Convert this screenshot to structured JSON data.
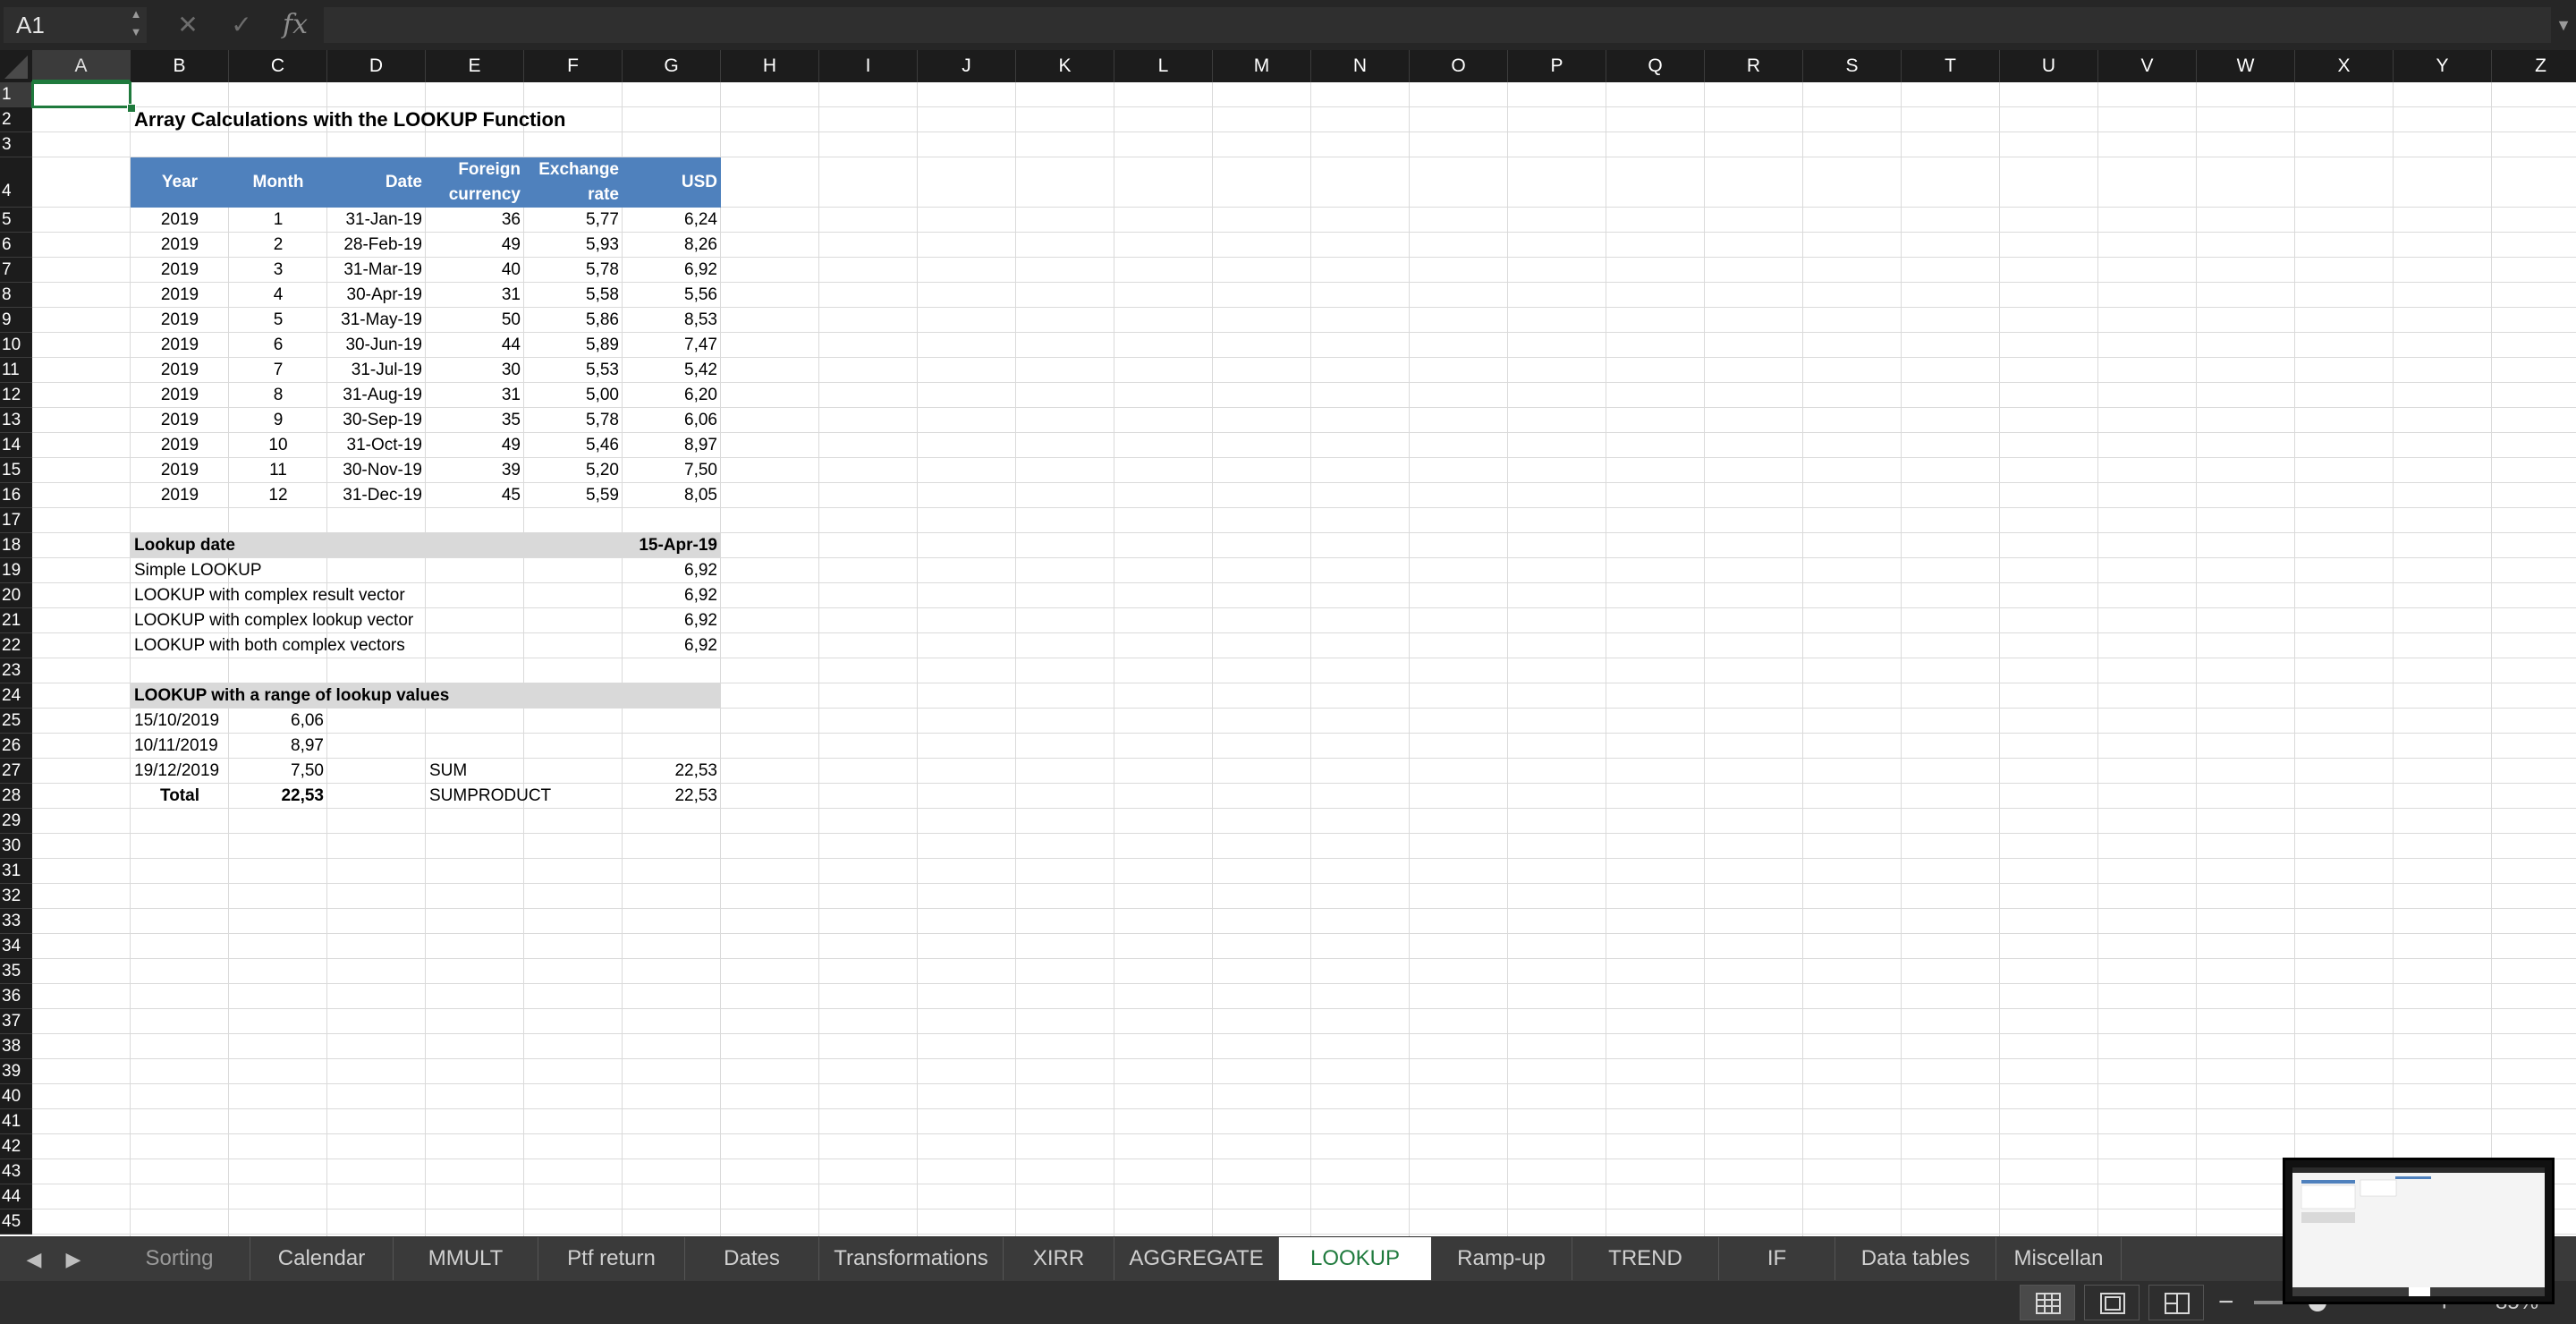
{
  "formula_bar": {
    "name_box": "A1",
    "formula": "",
    "icons": {
      "stepper": "stepper-icon",
      "cancel": "x-icon",
      "confirm": "check-icon",
      "fx": "function-icon",
      "dropdown": "chevron-down-icon"
    },
    "fx_label": "fx"
  },
  "columns": [
    "A",
    "B",
    "C",
    "D",
    "E",
    "F",
    "G",
    "H",
    "I",
    "J",
    "K",
    "L",
    "M",
    "N",
    "O",
    "P",
    "Q",
    "R",
    "S",
    "T",
    "U",
    "V",
    "W",
    "X",
    "Y",
    "Z"
  ],
  "selected_column": "A",
  "rows": [
    "1",
    "2",
    "3",
    "4",
    "5",
    "6",
    "7",
    "8",
    "9",
    "10",
    "11",
    "12",
    "13",
    "14",
    "15",
    "16",
    "17",
    "18",
    "19",
    "20",
    "21",
    "22",
    "23",
    "24",
    "25",
    "26",
    "27",
    "28",
    "29",
    "30",
    "31",
    "32",
    "33",
    "34",
    "35",
    "36",
    "37",
    "38",
    "39",
    "40",
    "41",
    "42",
    "43",
    "44",
    "45"
  ],
  "selected_row": "1",
  "sheet": {
    "title": "Array Calculations with the LOOKUP Function",
    "table_headers": {
      "year": "Year",
      "month": "Month",
      "date": "Date",
      "foreign_line1": "Foreign",
      "foreign_line2": "currency",
      "rate_line1": "Exchange",
      "rate_line2": "rate",
      "usd": "USD"
    },
    "table_rows": [
      [
        "2019",
        "1",
        "31-Jan-19",
        "36",
        "5,77",
        "6,24"
      ],
      [
        "2019",
        "2",
        "28-Feb-19",
        "49",
        "5,93",
        "8,26"
      ],
      [
        "2019",
        "3",
        "31-Mar-19",
        "40",
        "5,78",
        "6,92"
      ],
      [
        "2019",
        "4",
        "30-Apr-19",
        "31",
        "5,58",
        "5,56"
      ],
      [
        "2019",
        "5",
        "31-May-19",
        "50",
        "5,86",
        "8,53"
      ],
      [
        "2019",
        "6",
        "30-Jun-19",
        "44",
        "5,89",
        "7,47"
      ],
      [
        "2019",
        "7",
        "31-Jul-19",
        "30",
        "5,53",
        "5,42"
      ],
      [
        "2019",
        "8",
        "31-Aug-19",
        "31",
        "5,00",
        "6,20"
      ],
      [
        "2019",
        "9",
        "30-Sep-19",
        "35",
        "5,78",
        "6,06"
      ],
      [
        "2019",
        "10",
        "31-Oct-19",
        "49",
        "5,46",
        "8,97"
      ],
      [
        "2019",
        "11",
        "30-Nov-19",
        "39",
        "5,20",
        "7,50"
      ],
      [
        "2019",
        "12",
        "31-Dec-19",
        "45",
        "5,59",
        "8,05"
      ]
    ],
    "lookup_date_label": "Lookup date",
    "lookup_date_value": "15-Apr-19",
    "lookup_results": [
      {
        "label": "Simple LOOKUP",
        "value": "6,92"
      },
      {
        "label": "LOOKUP with complex result vector",
        "value": "6,92"
      },
      {
        "label": "LOOKUP with complex lookup vector",
        "value": "6,92"
      },
      {
        "label": "LOOKUP with both complex vectors",
        "value": "6,92"
      }
    ],
    "range_header": "LOOKUP with a range of lookup values",
    "range_rows": [
      {
        "date": "15/10/2019",
        "value": "6,06"
      },
      {
        "date": "10/11/2019",
        "value": "8,97"
      },
      {
        "date": "19/12/2019",
        "value": "7,50"
      }
    ],
    "sum_label": "SUM",
    "sum_value": "22,53",
    "total_label": "Total",
    "total_value": "22,53",
    "sumproduct_label": "SUMPRODUCT",
    "sumproduct_value": "22,53"
  },
  "tabs": [
    {
      "label": "Sorting",
      "active": false
    },
    {
      "label": "Calendar",
      "active": false
    },
    {
      "label": "MMULT",
      "active": false
    },
    {
      "label": "Ptf return",
      "active": false
    },
    {
      "label": "Dates",
      "active": false
    },
    {
      "label": "Transformations",
      "active": false
    },
    {
      "label": "XIRR",
      "active": false
    },
    {
      "label": "AGGREGATE",
      "active": false
    },
    {
      "label": "LOOKUP",
      "active": true
    },
    {
      "label": "Ramp-up",
      "active": false
    },
    {
      "label": "TREND",
      "active": false
    },
    {
      "label": "IF",
      "active": false
    },
    {
      "label": "Data tables",
      "active": false
    },
    {
      "label": "Miscellan",
      "active": false
    }
  ],
  "tab_nav": {
    "prev": "chevron-left-icon",
    "next": "chevron-right-icon"
  },
  "status_bar": {
    "views": [
      "normal-view-icon",
      "page-layout-icon",
      "page-break-preview-icon"
    ],
    "active_view": "normal-view-icon",
    "zoom_level": "85%",
    "zoom_fraction": 0.38
  },
  "colors": {
    "table_header": "#4f81bd",
    "gray_band": "#d9d9d9",
    "accent_green": "#1f7a3d",
    "chrome_dark": "#1c1c1c"
  }
}
